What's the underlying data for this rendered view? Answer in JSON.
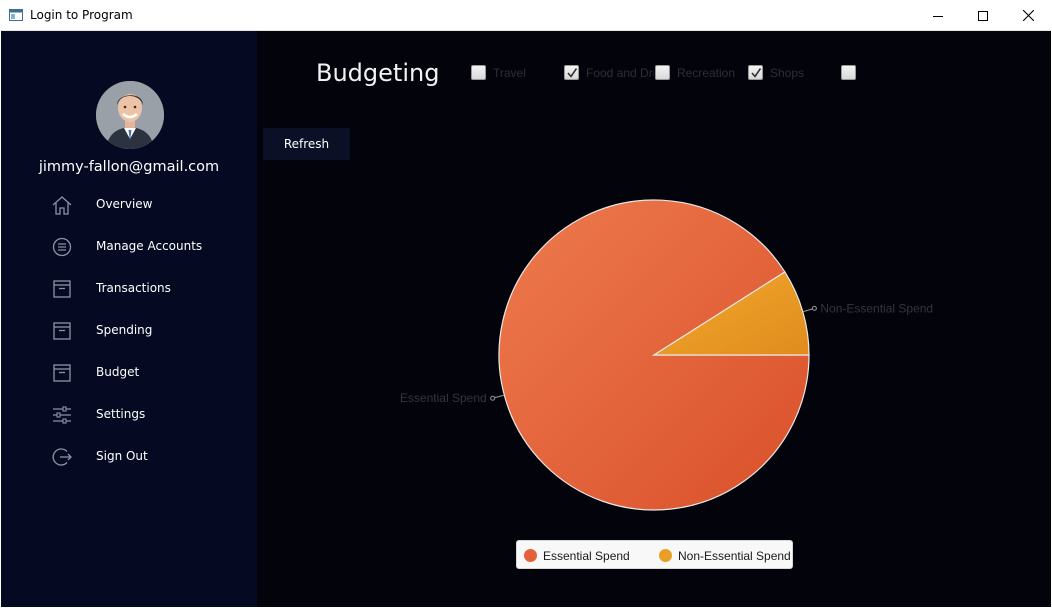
{
  "window": {
    "title": "Login to Program",
    "controls": [
      "minimize",
      "maximize",
      "close"
    ]
  },
  "sidebar": {
    "email": "jimmy-fallon@gmail.com",
    "items": [
      {
        "label": "Overview",
        "icon": "home-icon"
      },
      {
        "label": "Manage Accounts",
        "icon": "list-circle-icon"
      },
      {
        "label": "Transactions",
        "icon": "archive-icon"
      },
      {
        "label": "Spending",
        "icon": "archive-icon"
      },
      {
        "label": "Budget",
        "icon": "archive-icon"
      },
      {
        "label": "Settings",
        "icon": "sliders-icon"
      },
      {
        "label": "Sign Out",
        "icon": "sign-out-icon"
      }
    ]
  },
  "main": {
    "title": "Budgeting",
    "refresh_label": "Refresh",
    "categories": [
      {
        "label": "Travel",
        "checked": false
      },
      {
        "label": "Food and Dri",
        "checked": true
      },
      {
        "label": "Recreation",
        "checked": false
      },
      {
        "label": "Shops",
        "checked": true
      },
      {
        "label": "",
        "checked": false
      }
    ]
  },
  "colors": {
    "sidebar_bg": "#050a22",
    "main_bg": "#03040b",
    "essential": "#e4603a",
    "non_essential": "#eb9e26"
  },
  "chart_data": {
    "type": "pie",
    "slices": [
      {
        "label": "Essential Spend",
        "value": 91
      },
      {
        "label": "Non-Essential Spend",
        "value": 9
      }
    ],
    "legend": [
      "Essential Spend",
      "Non-Essential Spend"
    ],
    "legend_position": "bottom"
  }
}
